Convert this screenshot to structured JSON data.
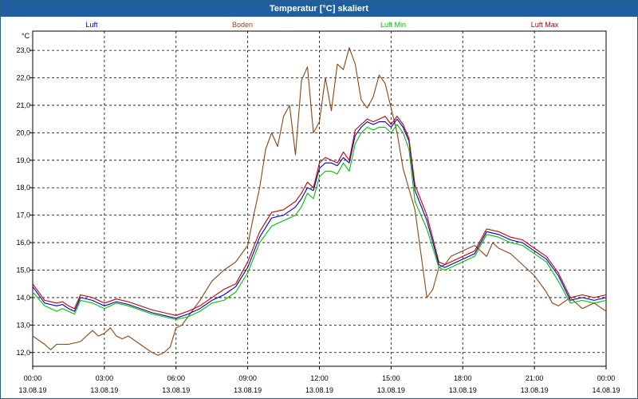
{
  "window": {
    "title": "Temperatur [°C] skaliert"
  },
  "chart_data": {
    "type": "line",
    "title": "Temperatur [°C] skaliert",
    "ylabel": "°C",
    "ylim": [
      11.5,
      23.7
    ],
    "y_ticks": [
      "12,0",
      "13,0",
      "14,0",
      "15,0",
      "16,0",
      "17,0",
      "18,0",
      "19,0",
      "20,0",
      "21,0",
      "22,0",
      "23,0"
    ],
    "xlim": [
      0,
      24
    ],
    "x_ticks": [
      {
        "time": "00:00",
        "date": "13.08.19"
      },
      {
        "time": "03:00",
        "date": "13.08.19"
      },
      {
        "time": "06:00",
        "date": "13.08.19"
      },
      {
        "time": "09:00",
        "date": "13.08.19"
      },
      {
        "time": "12:00",
        "date": "13.08.19"
      },
      {
        "time": "15:00",
        "date": "13.08.19"
      },
      {
        "time": "18:00",
        "date": "13.08.19"
      },
      {
        "time": "21:00",
        "date": "13.08.19"
      },
      {
        "time": "00:00",
        "date": "14.08.19"
      }
    ],
    "grid": true,
    "legend_position": "top",
    "series": [
      {
        "name": "Boden",
        "color": "#8b4513",
        "x": [
          0,
          0.5,
          0.75,
          1,
          1.5,
          2,
          2.5,
          2.75,
          3,
          3.25,
          3.5,
          3.75,
          4,
          4.5,
          5,
          5.25,
          5.5,
          5.75,
          6,
          6.25,
          6.5,
          7,
          7.5,
          8,
          8.5,
          9,
          9.25,
          9.5,
          9.75,
          10,
          10.25,
          10.5,
          10.75,
          11,
          11.25,
          11.5,
          11.75,
          12,
          12.25,
          12.5,
          12.75,
          13,
          13.25,
          13.5,
          13.75,
          14,
          14.25,
          14.5,
          14.75,
          15,
          15.25,
          15.5,
          16,
          16.5,
          16.75,
          17,
          17.25,
          17.5,
          18,
          18.5,
          19,
          19.25,
          19.5,
          20,
          20.5,
          21,
          21.5,
          21.75,
          22,
          22.5,
          23,
          23.5,
          24
        ],
        "y": [
          12.6,
          12.3,
          12.1,
          12.3,
          12.3,
          12.4,
          12.8,
          12.6,
          12.7,
          12.9,
          12.6,
          12.5,
          12.6,
          12.3,
          12.0,
          11.9,
          12.0,
          12.2,
          12.9,
          13.0,
          13.3,
          13.9,
          14.6,
          15.0,
          15.3,
          15.9,
          17.0,
          18.0,
          19.4,
          20.0,
          19.5,
          20.6,
          21.0,
          19.2,
          21.9,
          22.4,
          20.0,
          20.4,
          22.0,
          20.8,
          22.5,
          22.3,
          23.1,
          22.5,
          21.2,
          20.9,
          21.3,
          22.1,
          21.8,
          20.9,
          20.0,
          18.7,
          17.2,
          14.0,
          14.3,
          15.1,
          15.2,
          15.5,
          15.7,
          15.9,
          15.5,
          16.0,
          15.8,
          15.6,
          15.2,
          14.8,
          14.2,
          13.8,
          13.7,
          14.0,
          13.6,
          13.8,
          13.5
        ]
      },
      {
        "name": "Luft Min",
        "color": "#00c000",
        "x": [
          0,
          0.5,
          1,
          1.25,
          1.5,
          1.75,
          2,
          2.5,
          3,
          3.5,
          4,
          5,
          5.5,
          6,
          6.5,
          7,
          7.5,
          8,
          8.5,
          9,
          9.5,
          10,
          10.5,
          11,
          11.25,
          11.5,
          11.75,
          12,
          12.25,
          12.5,
          12.75,
          13,
          13.25,
          13.5,
          13.75,
          14,
          14.25,
          14.5,
          14.75,
          15,
          15.25,
          15.5,
          15.75,
          16,
          16.5,
          17,
          17.25,
          17.5,
          17.75,
          18,
          18.5,
          19,
          19.5,
          20,
          20.5,
          21,
          21.5,
          22,
          22.5,
          23,
          23.5,
          24
        ],
        "y": [
          14.2,
          13.7,
          13.5,
          13.6,
          13.5,
          13.4,
          13.9,
          13.8,
          13.6,
          13.8,
          13.7,
          13.4,
          13.3,
          13.2,
          13.3,
          13.5,
          13.8,
          13.9,
          14.2,
          14.9,
          16.0,
          16.6,
          16.8,
          17.0,
          17.3,
          17.8,
          17.6,
          18.4,
          18.6,
          18.6,
          18.5,
          18.9,
          18.6,
          19.6,
          20.0,
          20.2,
          20.1,
          20.2,
          20.2,
          20.0,
          20.3,
          20.0,
          19.4,
          17.5,
          16.5,
          15.1,
          15.0,
          15.1,
          15.2,
          15.3,
          15.5,
          16.3,
          16.2,
          16.0,
          15.9,
          15.6,
          15.3,
          14.6,
          13.8,
          13.9,
          13.8,
          13.9
        ]
      },
      {
        "name": "Luft",
        "color": "#0000c0",
        "x": [
          0,
          0.5,
          1,
          1.25,
          1.5,
          1.75,
          2,
          2.5,
          3,
          3.5,
          4,
          5,
          5.5,
          6,
          6.5,
          7,
          7.5,
          8,
          8.5,
          9,
          9.5,
          10,
          10.5,
          11,
          11.25,
          11.5,
          11.75,
          12,
          12.25,
          12.5,
          12.75,
          13,
          13.25,
          13.5,
          13.75,
          14,
          14.25,
          14.5,
          14.75,
          15,
          15.25,
          15.5,
          15.75,
          16,
          16.5,
          17,
          17.25,
          17.5,
          17.75,
          18,
          18.5,
          19,
          19.5,
          20,
          20.5,
          21,
          21.5,
          22,
          22.5,
          23,
          23.5,
          24
        ],
        "y": [
          14.4,
          13.8,
          13.7,
          13.75,
          13.6,
          13.5,
          14.0,
          13.9,
          13.7,
          13.85,
          13.75,
          13.45,
          13.35,
          13.25,
          13.4,
          13.6,
          13.9,
          14.1,
          14.4,
          15.1,
          16.2,
          16.9,
          17.0,
          17.3,
          17.6,
          18.0,
          17.9,
          18.7,
          18.9,
          18.9,
          18.8,
          19.1,
          18.9,
          19.9,
          20.2,
          20.4,
          20.3,
          20.4,
          20.4,
          20.2,
          20.5,
          20.2,
          19.7,
          17.9,
          16.8,
          15.2,
          15.1,
          15.2,
          15.3,
          15.4,
          15.6,
          16.4,
          16.3,
          16.1,
          16.0,
          15.7,
          15.4,
          14.8,
          13.9,
          14.0,
          13.9,
          14.0
        ]
      },
      {
        "name": "Luft Max",
        "color": "#c00000",
        "x": [
          0,
          0.5,
          1,
          1.25,
          1.5,
          1.75,
          2,
          2.5,
          3,
          3.5,
          4,
          5,
          5.5,
          6,
          6.5,
          7,
          7.5,
          8,
          8.5,
          9,
          9.5,
          10,
          10.5,
          11,
          11.25,
          11.5,
          11.75,
          12,
          12.25,
          12.5,
          12.75,
          13,
          13.25,
          13.5,
          13.75,
          14,
          14.25,
          14.5,
          14.75,
          15,
          15.25,
          15.5,
          15.75,
          16,
          16.5,
          17,
          17.25,
          17.5,
          17.75,
          18,
          18.5,
          19,
          19.5,
          20,
          20.5,
          21,
          21.5,
          22,
          22.5,
          23,
          23.5,
          24
        ],
        "y": [
          14.5,
          13.9,
          13.8,
          13.85,
          13.7,
          13.6,
          14.1,
          14.0,
          13.8,
          13.95,
          13.85,
          13.55,
          13.45,
          13.35,
          13.5,
          13.7,
          14.0,
          14.3,
          14.5,
          15.3,
          16.4,
          17.1,
          17.2,
          17.5,
          17.8,
          18.2,
          18.0,
          18.9,
          19.1,
          19.0,
          18.9,
          19.3,
          19.0,
          20.1,
          20.3,
          20.5,
          20.4,
          20.5,
          20.6,
          20.3,
          20.6,
          20.3,
          19.8,
          18.1,
          17.0,
          15.3,
          15.2,
          15.3,
          15.4,
          15.5,
          15.7,
          16.5,
          16.4,
          16.2,
          16.1,
          15.8,
          15.5,
          14.9,
          14.0,
          14.1,
          14.0,
          14.1
        ]
      }
    ]
  }
}
